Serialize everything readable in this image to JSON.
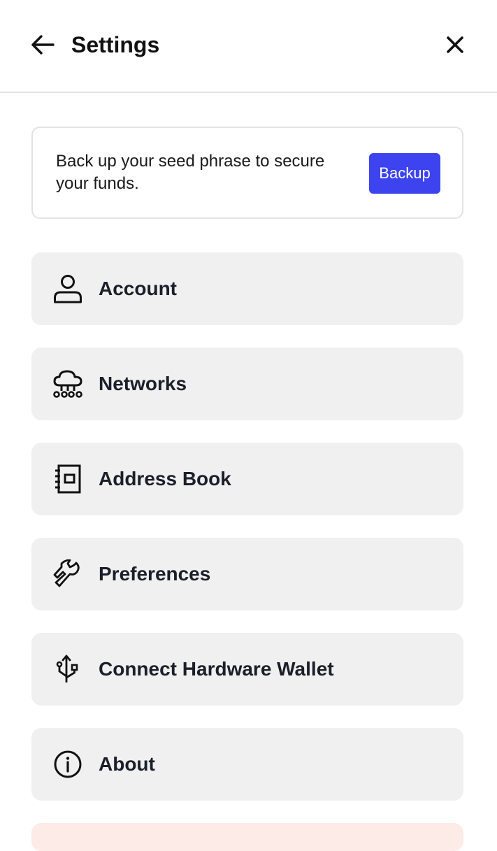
{
  "header": {
    "title": "Settings",
    "back_icon": "arrow-left-icon",
    "close_icon": "close-icon"
  },
  "backup_banner": {
    "message": "Back up your seed phrase to secure your funds.",
    "button_label": "Backup",
    "button_color": "#3c43ef"
  },
  "menu": {
    "items": [
      {
        "label": "Account",
        "icon": "user-icon"
      },
      {
        "label": "Networks",
        "icon": "cloud-network-icon"
      },
      {
        "label": "Address Book",
        "icon": "address-book-icon"
      },
      {
        "label": "Preferences",
        "icon": "wrench-icon"
      },
      {
        "label": "Connect Hardware Wallet",
        "icon": "usb-icon"
      },
      {
        "label": "About",
        "icon": "info-icon"
      }
    ]
  },
  "colors": {
    "menu_item_bg": "#eff0ef",
    "danger_item_bg": "#fcebe6",
    "divider": "#e2e4e3"
  }
}
